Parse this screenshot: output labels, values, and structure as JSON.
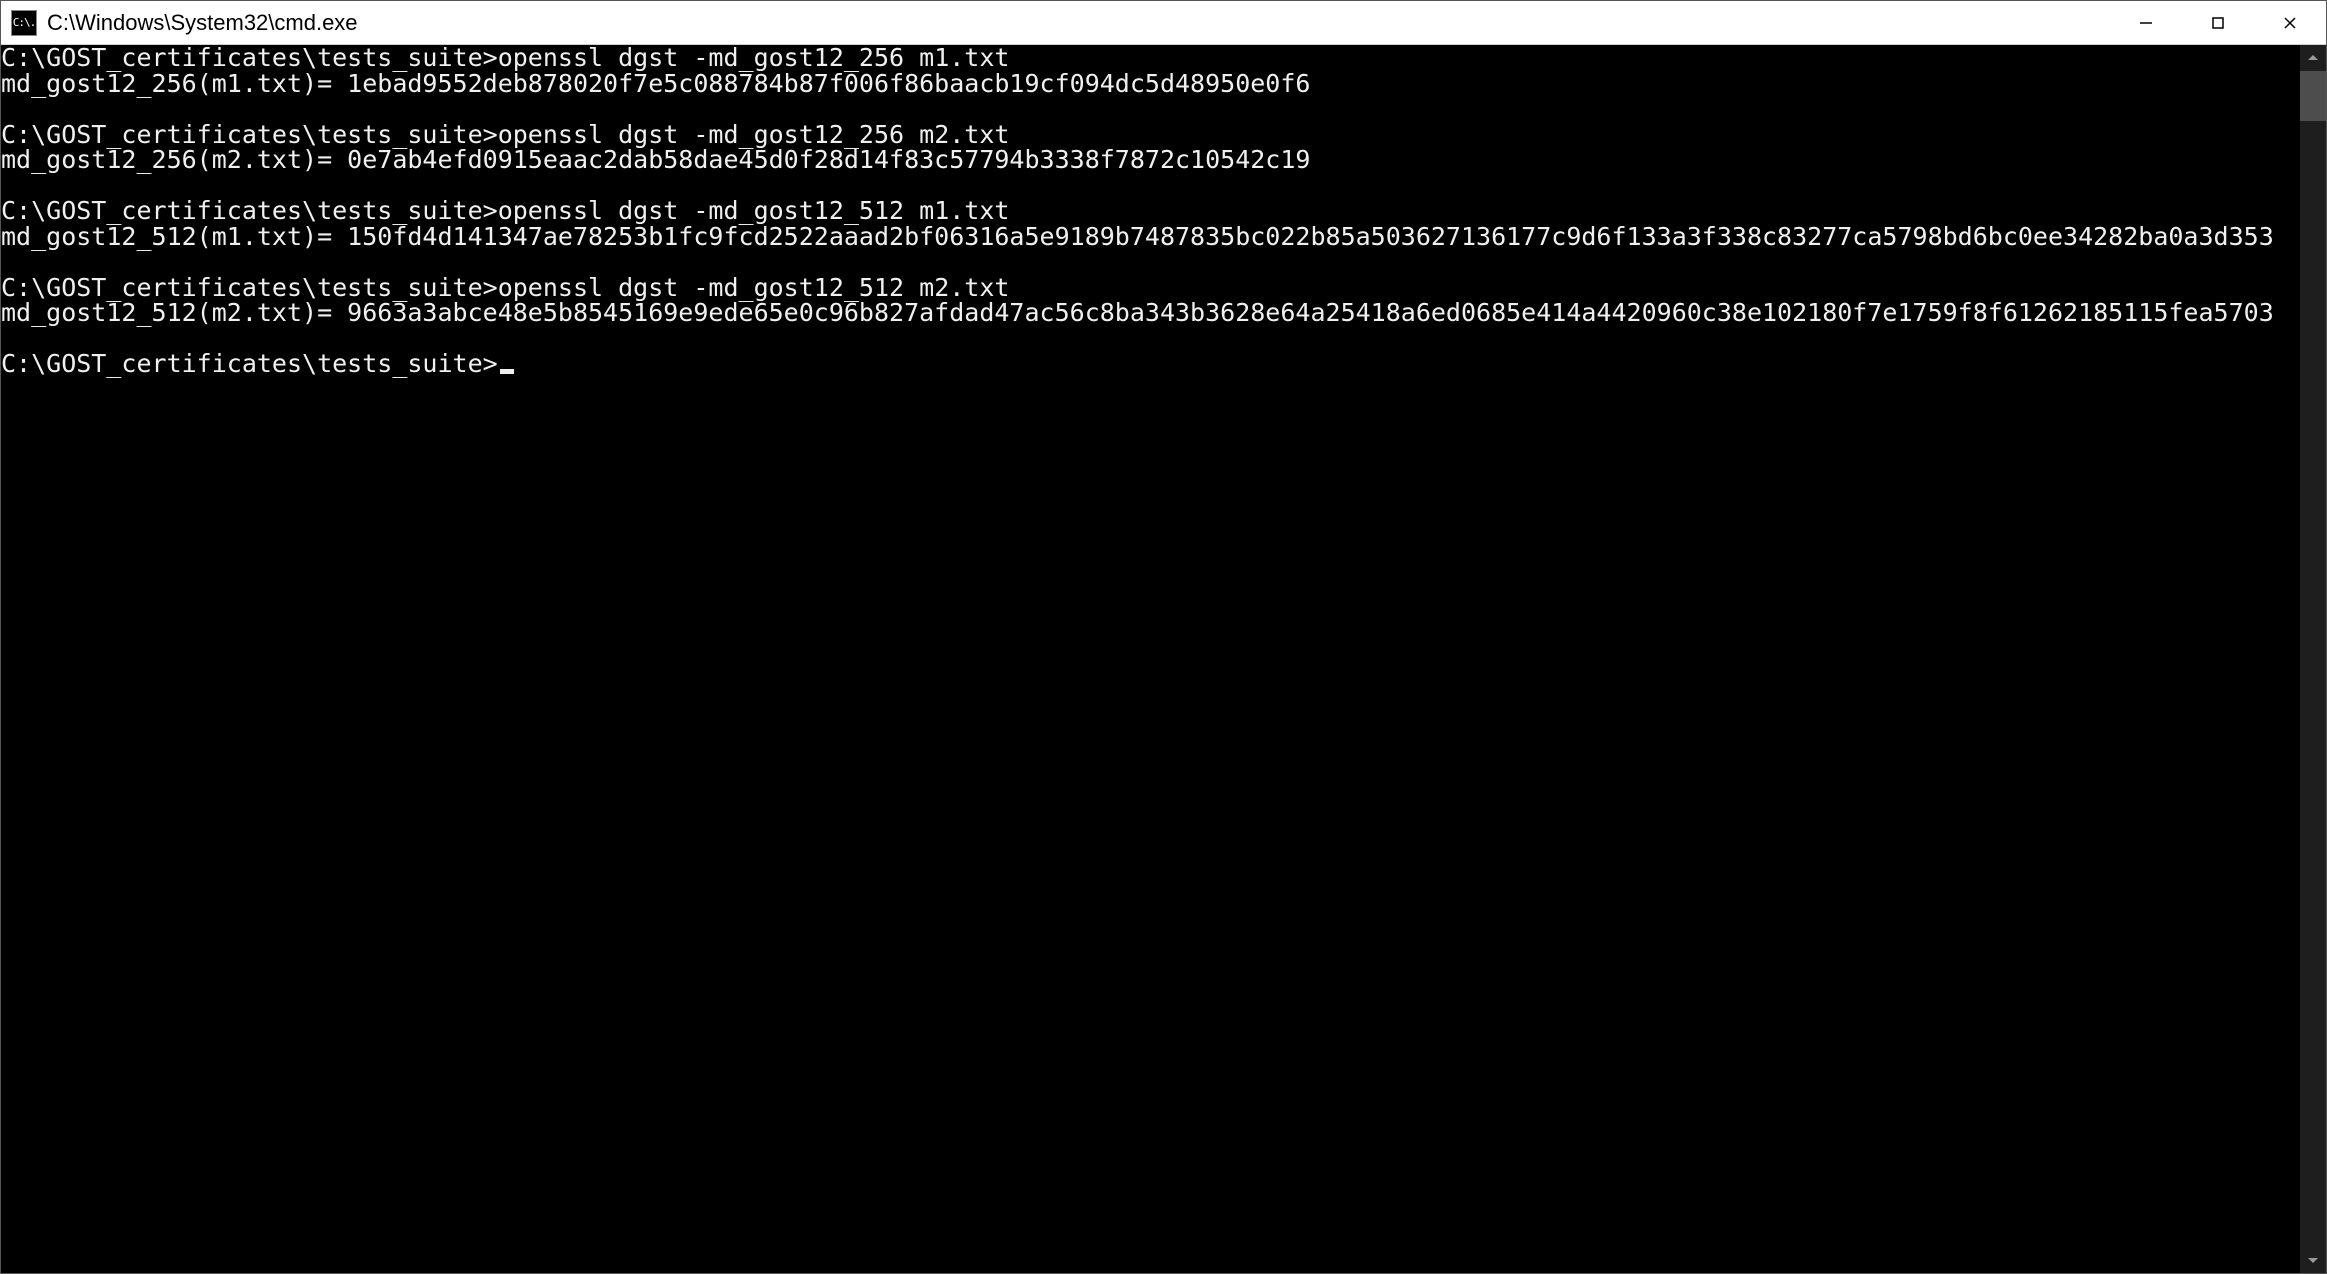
{
  "window": {
    "title": "C:\\Windows\\System32\\cmd.exe",
    "icon_label": "C:\\."
  },
  "controls": {
    "minimize_label": "Minimize",
    "maximize_label": "Maximize",
    "close_label": "Close"
  },
  "prompt": "C:\\GOST_certificates\\tests_suite>",
  "blocks": [
    {
      "command": "openssl dgst -md_gost12_256 m1.txt",
      "output": "md_gost12_256(m1.txt)= 1ebad9552deb878020f7e5c088784b87f006f86baacb19cf094dc5d48950e0f6"
    },
    {
      "command": "openssl dgst -md_gost12_256 m2.txt",
      "output": "md_gost12_256(m2.txt)= 0e7ab4efd0915eaac2dab58dae45d0f28d14f83c57794b3338f7872c10542c19"
    },
    {
      "command": "openssl dgst -md_gost12_512 m1.txt",
      "output": "md_gost12_512(m1.txt)= 150fd4d141347ae78253b1fc9fcd2522aaad2bf06316a5e9189b7487835bc022b85a503627136177c9d6f133a3f338c83277ca5798bd6bc0ee34282ba0a3d353"
    },
    {
      "command": "openssl dgst -md_gost12_512 m2.txt",
      "output": "md_gost12_512(m2.txt)= 9663a3abce48e5b8545169e9ede65e0c96b827afdad47ac56c8ba343b3628e64a25418a6ed0685e414a4420960c38e102180f7e1759f8f61262185115fea5703"
    }
  ]
}
